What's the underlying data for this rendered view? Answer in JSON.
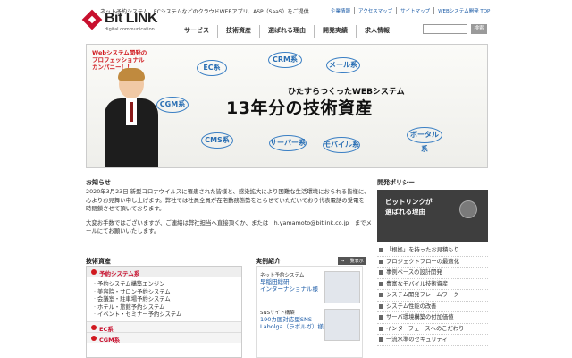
{
  "header": {
    "tagline": "ネット予約システム、ECシステムなどのクラウドWEBアプリ、ASP（SaaS）をご提供",
    "logo_text": "Bit LINK",
    "logo_sub": "digital communication",
    "util_links": [
      "企業情報",
      "アクセスマップ",
      "サイトマップ",
      "WEBシステム開発 TOP"
    ],
    "nav": [
      "サービス",
      "技術資産",
      "選ばれる理由",
      "開発実績",
      "求人情報"
    ],
    "search_button": "検索",
    "search_placeholder": ""
  },
  "hero": {
    "bubble_text": "Webシステム開発の\nプロフェッショナル\nカンパニー！！",
    "subtitle": "ひたすらつくったWEBシステム",
    "title": "13年分の技術資産",
    "bubbles": [
      "EC系",
      "CRM系",
      "メール系",
      "CGM系",
      "CMS系",
      "サーバー系",
      "モバイル系",
      "ポータル系"
    ]
  },
  "news": {
    "title": "お知らせ",
    "para1": "2020年3月23日 新型コロナウイルスに罹患された皆様と、感染拡大により困難な生活環境におられる皆様に、心よりお見舞い申し上げます。弊社では社員全員が在宅勤務態勢をとらせていただいており代表電話の受電を一時閉鎖させて頂いております。",
    "para2": "大変お手数ではございますが、ご連絡は弊社担当へ直接頂くか、または　h.yamamoto@bitlink.co.jp　までメールにてお願いいたします。"
  },
  "tech": {
    "title": "技術資産",
    "category1": "予約システム系",
    "items": [
      "予約システム構築エンジン",
      "美容院・サロン予約システム",
      "会議室・駐車場予約システム",
      "ホテル・旅館予約システム",
      "イベント・セミナー予約システム"
    ],
    "category2": "EC系",
    "category3": "CGM系"
  },
  "cases": {
    "title": "実例紹介",
    "all_link": "→ 一覧表示",
    "case1_kind": "ネット予約システム",
    "case1_name1": "早稲田総研",
    "case1_name2": "インターナショナル様",
    "case2_kind": "SNSサイト構築",
    "case2_name1": "190カ国対応型SNS",
    "case2_name2": "Labolga（ラボルガ）様"
  },
  "policy": {
    "title": "開発ポリシー",
    "banner_text": "ビットリンクが\n選ばれる理由",
    "items": [
      "「根拠」を持ったお見積もり",
      "プロジェクトフローの最適化",
      "事例ベースの設計開発",
      "豊富なモバイル技術資産",
      "システム開発フレームワーク",
      "システム性能の改善",
      "サーバ環境構築の付加価値",
      "インターフェースへのこだわり",
      "一流水準のセキュリティ"
    ]
  },
  "colors": {
    "brand": "#c8102e",
    "link": "#1a5aa6",
    "bubble": "#3a7fc4"
  }
}
